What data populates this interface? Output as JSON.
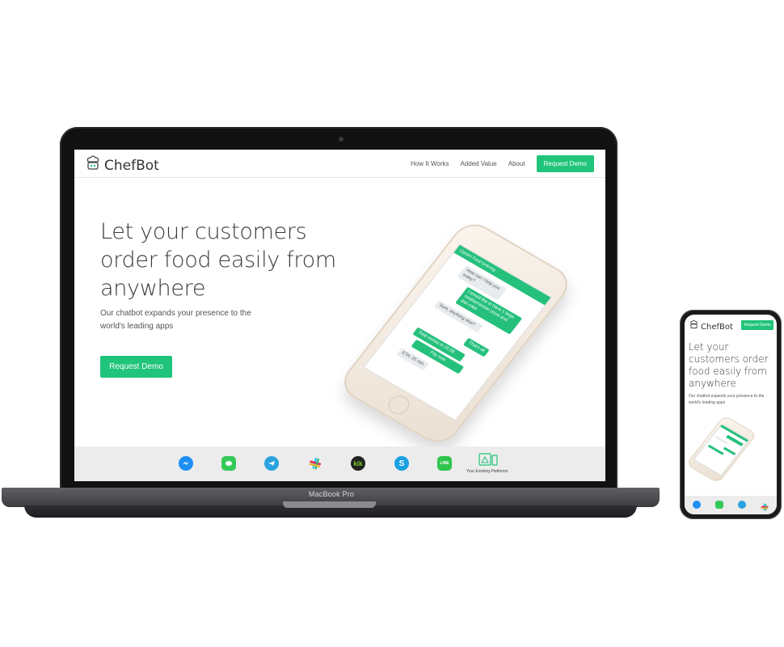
{
  "laptop": {
    "brand_label": "MacBook Pro",
    "site": {
      "logo_text": "ChefBot",
      "nav": {
        "links": [
          "How It Works",
          "Added Value",
          "About"
        ],
        "cta": "Request Demo"
      },
      "hero": {
        "title": "Let your customers order food easily from anywhere",
        "subtitle": "Our chatbot expands your presence to the world's leading apps",
        "cta": "Request Demo"
      },
      "phone_chat": {
        "header": "Cipriani Food Ordering",
        "messages": [
          {
            "from": "bot",
            "text": "How can I help you today?"
          },
          {
            "from": "user",
            "text": "I would like to have 1 large mediterranean pizza and diet coke"
          },
          {
            "from": "bot",
            "text": "Sure, anything else?"
          },
          {
            "from": "user",
            "text": "That's all"
          },
          {
            "from": "bot",
            "text": "Total comes to 25.5$"
          },
          {
            "from": "bot",
            "text": "Pay now"
          },
          {
            "from": "bot",
            "text": "ETA: 25 min."
          }
        ]
      },
      "platforms": {
        "icons": [
          "messenger-icon",
          "imessage-icon",
          "telegram-icon",
          "slack-icon",
          "kik-icon",
          "skype-icon",
          "line-icon",
          "existing-platforms-icon"
        ],
        "kik_text": "kik",
        "line_text": "LINE",
        "existing_label": "Your Existing Platforms"
      }
    }
  },
  "mobile": {
    "logo_text": "ChefBot",
    "cta": "Request Demo",
    "title": "Let your customers order food easily from anywhere",
    "subtitle": "Our chatbot expands your presence to the world's leading apps"
  },
  "colors": {
    "accent": "#20c47a",
    "text_dark": "#3a3a3a",
    "platform_bar": "#ececec",
    "device_frame": "#111111"
  }
}
